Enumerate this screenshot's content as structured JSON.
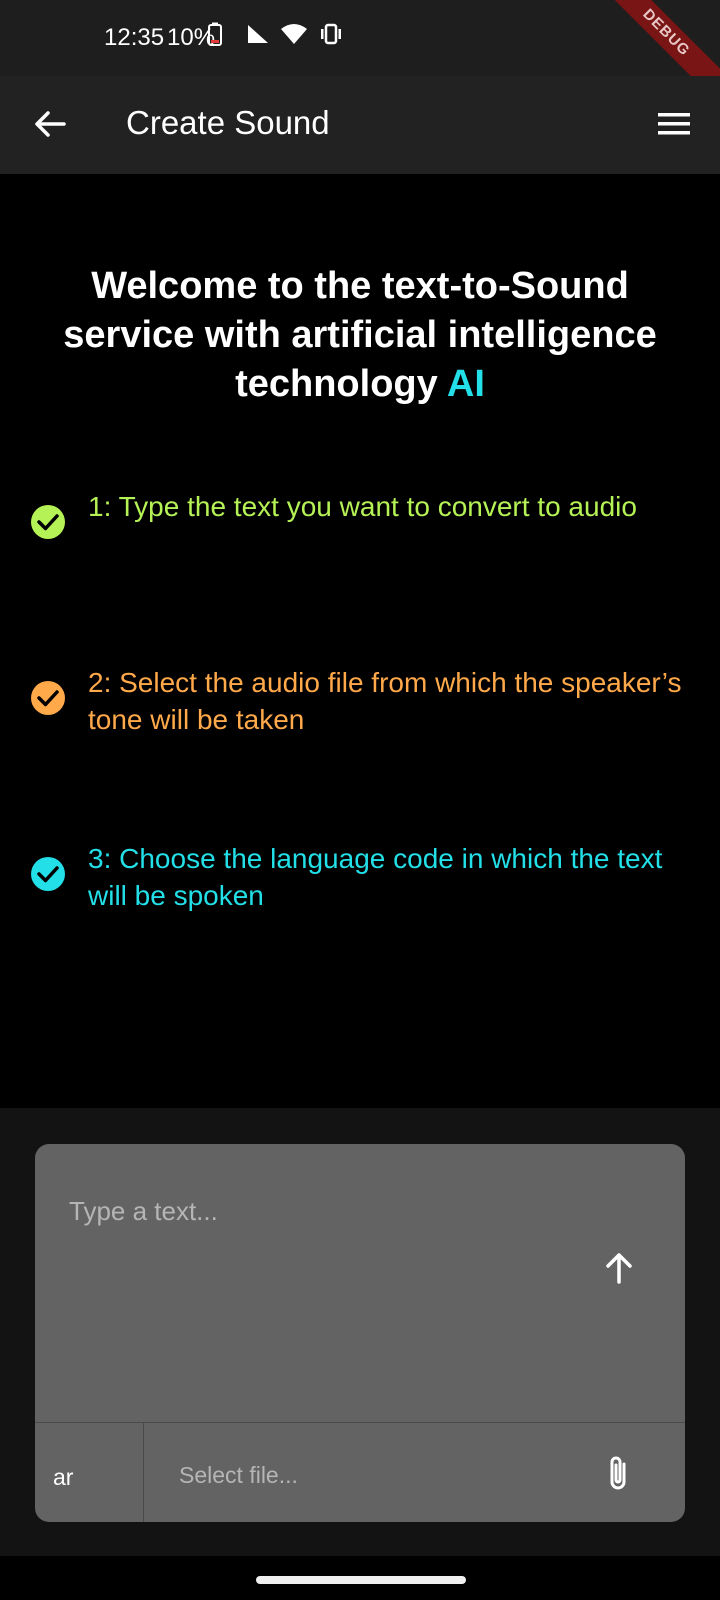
{
  "status_bar": {
    "time": "12:35",
    "battery": "10%",
    "debug_label": "DEBUG"
  },
  "app_bar": {
    "title": "Create Sound",
    "back_icon": "arrow-left-icon",
    "menu_icon": "hamburger-menu-icon"
  },
  "welcome": {
    "text": "Welcome to the text-to-Sound service with artificial intelligence technology",
    "highlight": "AI",
    "highlight_color": "#22dfe8"
  },
  "steps": [
    {
      "text": "1: Type the text you want to convert to audio",
      "color": "#b5f255"
    },
    {
      "text": "2: Select the audio file from which the speaker’s tone will be taken",
      "color": "#ffa94a"
    },
    {
      "text": "3: Choose the language code in which the text will be spoken",
      "color": "#22dfe8"
    }
  ],
  "composer": {
    "text_placeholder": "Type a text...",
    "language_code": "ar",
    "file_placeholder": "Select file...",
    "send_icon": "arrow-up-icon",
    "attach_icon": "paperclip-icon"
  }
}
